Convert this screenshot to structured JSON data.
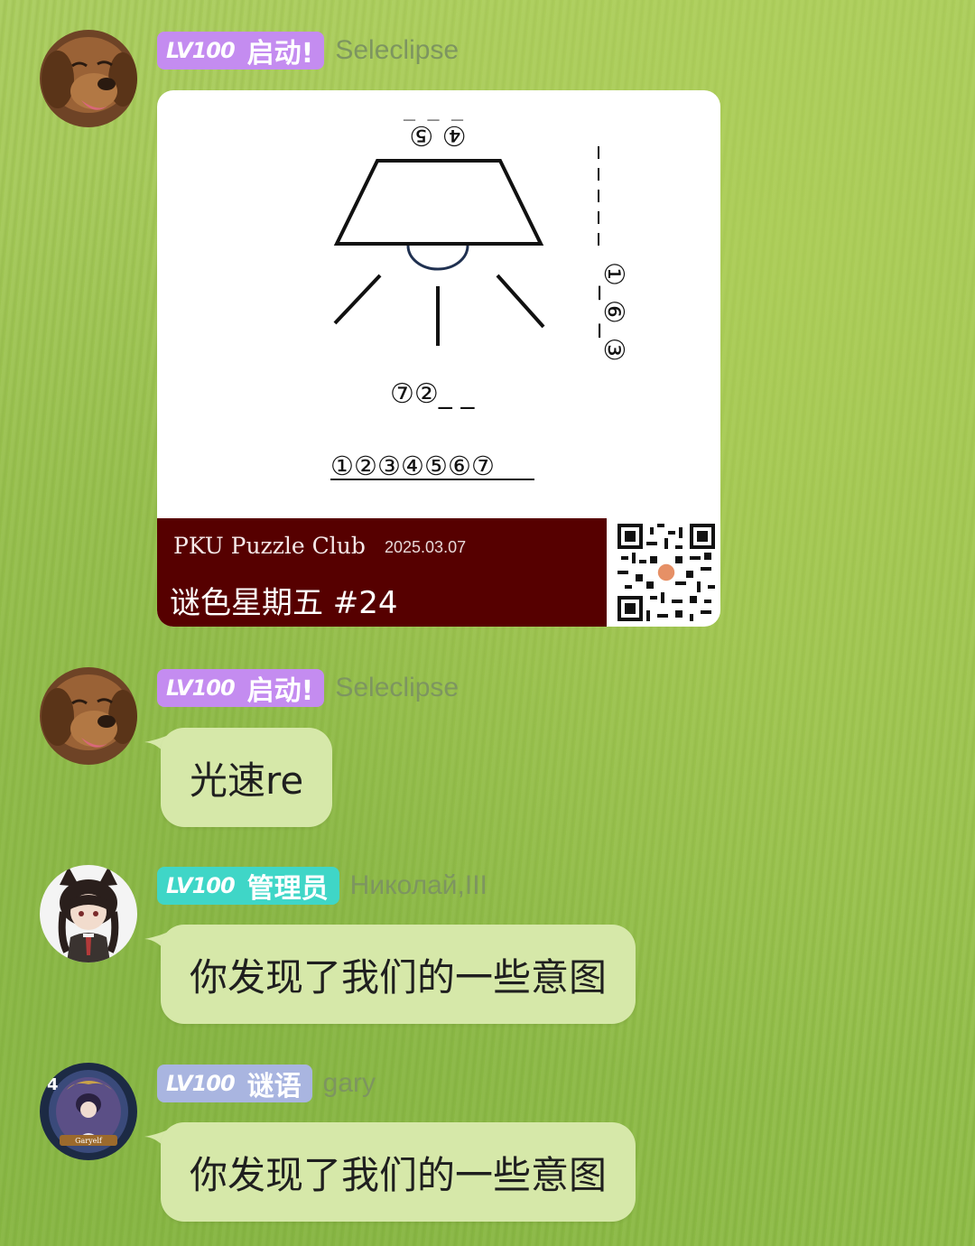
{
  "messages": [
    {
      "badge_level": "LV100",
      "badge_title": "启动!",
      "badge_color": "#c48cf0",
      "username": "Seleclipse",
      "avatar": "golden-retriever-avatar",
      "card": {
        "puzzle": {
          "top_circles": "④  ⑤",
          "top_blanks": "_ _ _",
          "side_text": "①_⑥_③",
          "bottom_hint": "⑦②_ _",
          "answer_line": "①②③④⑤⑥⑦"
        },
        "club": "PKU Puzzle Club",
        "date": "2025.03.07",
        "series": "谜色星期五 #24"
      }
    },
    {
      "badge_level": "LV100",
      "badge_title": "启动!",
      "badge_color": "#c48cf0",
      "username": "Seleclipse",
      "avatar": "golden-retriever-avatar",
      "text": "光速re"
    },
    {
      "badge_level": "LV100",
      "badge_title": "管理员",
      "badge_color": "#3fd6c7",
      "username": "Николай,III",
      "avatar": "anime-catgirl-avatar",
      "text": "你发现了我们的一些意图"
    },
    {
      "badge_level": "LV100",
      "badge_title": "谜语",
      "badge_color": "#a9b5e0",
      "username": "gary",
      "avatar": "hearthstone-hero-avatar",
      "avatar_caption": "Garyelf",
      "avatar_number": "4",
      "text": "你发现了我们的一些意图"
    }
  ]
}
